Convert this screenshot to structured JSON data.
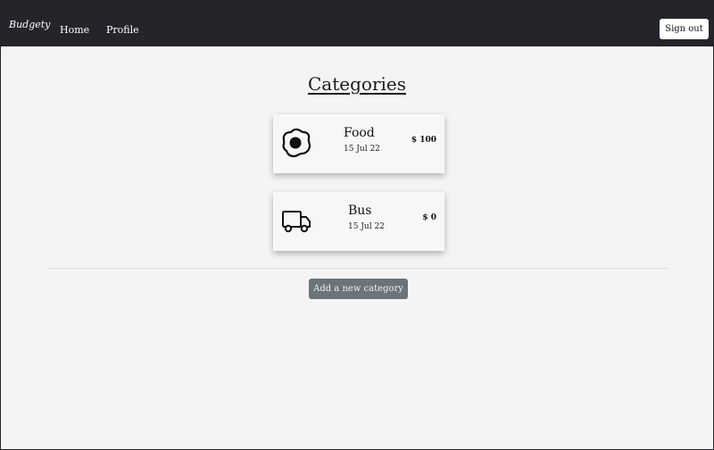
{
  "navbar": {
    "brand": "Budgety",
    "links": [
      {
        "label": "Home"
      },
      {
        "label": "Profile"
      }
    ],
    "sign_out_label": "Sign out"
  },
  "main": {
    "title": "Categories",
    "categories": [
      {
        "name": "Food",
        "date": "15 Jul 22",
        "amount": "$ 100",
        "icon": "fried-egg-icon"
      },
      {
        "name": "Bus",
        "date": "15 Jul 22",
        "amount": "$ 0",
        "icon": "truck-icon"
      }
    ],
    "add_button_label": "Add a new category"
  },
  "colors": {
    "navbar_bg": "#23252a",
    "page_bg": "#f4f4f4",
    "button_secondary": "#6c737a"
  }
}
